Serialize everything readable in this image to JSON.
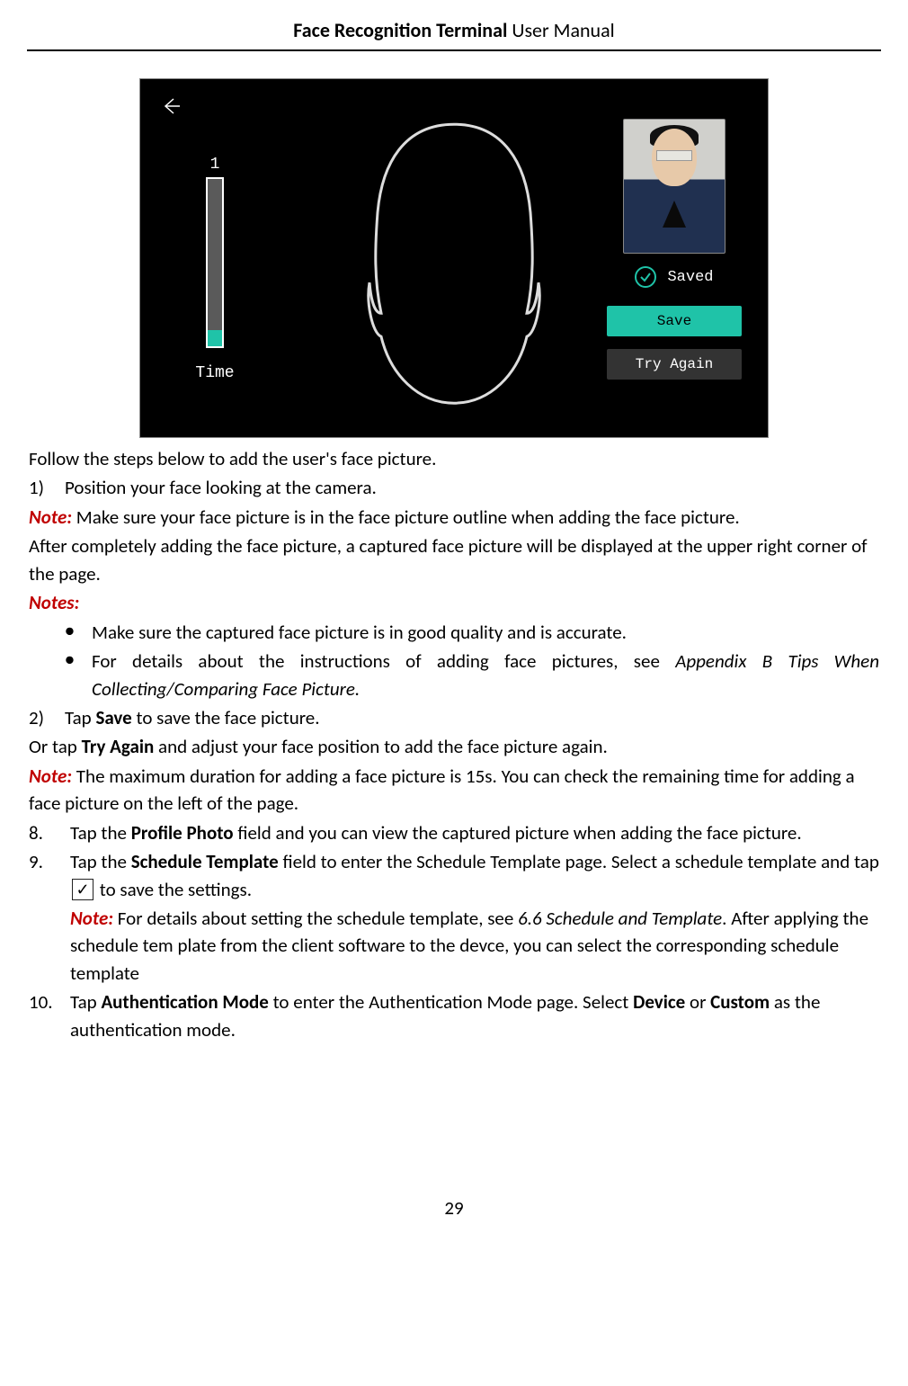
{
  "header": {
    "bold": "Face Recognition Terminal",
    "rest": " User Manual"
  },
  "screenshot": {
    "timer_number": "1",
    "timer_label": "Time",
    "status": "Saved",
    "save_btn": "Save",
    "try_btn": "Try Again"
  },
  "intro": "Follow the steps below to add the user's face picture.",
  "step1": {
    "num": "1)",
    "text": "Position your face looking at the camera.",
    "note_label": "Note:",
    "note_text": " Make sure your face picture is in the face picture outline when adding the face picture.",
    "after": "After completely adding the face picture, a captured face picture will be displayed at the upper right corner of the page.",
    "notes_label": "Notes:",
    "bullet1": "Make sure the captured face picture is in good quality and is accurate.",
    "bullet2a": "For details about the instructions of adding face pictures, see ",
    "bullet2b": "Appendix B Tips When Collecting/Comparing Face Picture."
  },
  "step2": {
    "num": "2)",
    "tap": "Tap ",
    "save": "Save",
    "rest": " to save the face picture.",
    "or1": "Or tap ",
    "try": "Try Again",
    "or2": " and adjust your face position to add the face picture again.",
    "note_label": "Note:",
    "note_text": " The maximum duration for adding a face picture is 15s. You can check the remaining time for adding a face picture on the left of the page."
  },
  "step8": {
    "num": "8.",
    "a": "Tap the ",
    "b": "Profile Photo",
    "c": " field and you can view the captured picture when adding the face picture."
  },
  "step9": {
    "num": "9.",
    "a": "Tap the ",
    "b": "Schedule Template",
    "c": " field to enter the Schedule Template page. Select a schedule template and tap ",
    "d": " to save the settings.",
    "note_label": "Note:",
    "note_a": " For details about setting the schedule template, see ",
    "note_b": "6.6 Schedule and Template",
    "note_c": ". After applying the schedule tem plate from the client software to the devce, you can select the corresponding schedule template"
  },
  "step10": {
    "num": "10.",
    "a": "Tap ",
    "b": "Authentication Mode",
    "c": " to enter the Authentication Mode page. Select ",
    "d": "Device",
    "e": " or ",
    "f": "Custom",
    "g": " as the authentication mode."
  },
  "page_number": "29"
}
